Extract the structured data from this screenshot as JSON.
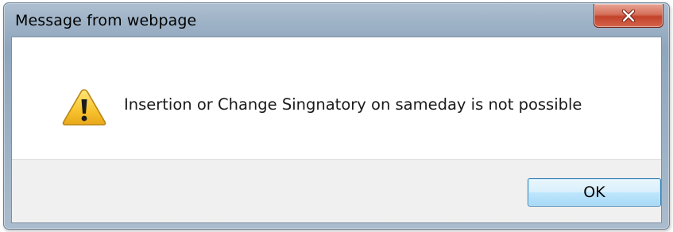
{
  "dialog": {
    "title": "Message from webpage",
    "message": "Insertion or Change Singnatory on sameday is not possible",
    "icon": "warning-icon",
    "ok_label": "OK",
    "close_icon": "close-icon"
  },
  "colors": {
    "title_bar": "#9fb3c7",
    "close_button": "#c3422a",
    "ok_button_border": "#3c7fb1",
    "footer_background": "#f0f0f0",
    "warning_yellow": "#f7c32e"
  }
}
